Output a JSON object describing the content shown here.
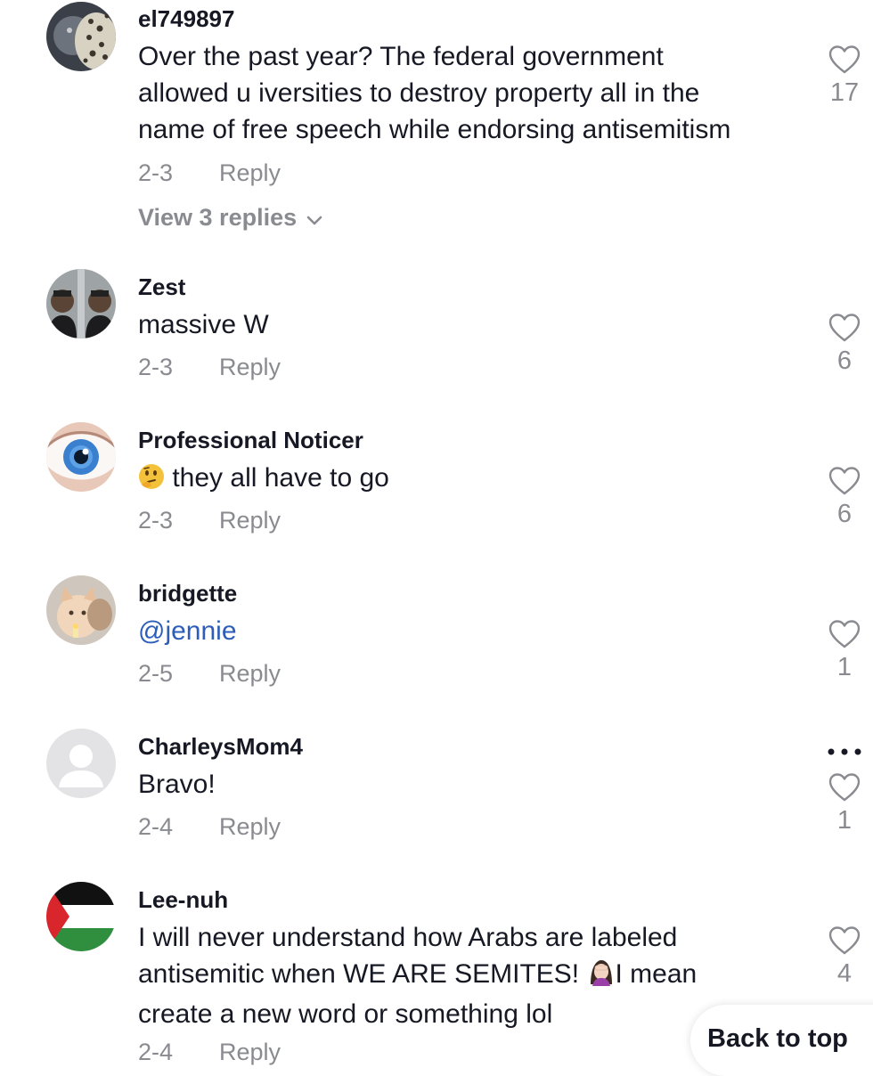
{
  "colors": {
    "text": "#161823",
    "meta": "#8a8b91",
    "mention": "#2b5db9"
  },
  "comments": [
    {
      "username": "el749897",
      "text_lines": [
        "Over the past year? The federal government",
        "allowed u iversities to destroy property all in the",
        "name of free speech while endorsing antisemitism"
      ],
      "date": "2-3",
      "reply_label": "Reply",
      "likes": "17",
      "view_replies": "View 3 replies",
      "avatar_icon": "leopard-cat-avatar"
    },
    {
      "username": "Zest",
      "text": "massive W",
      "date": "2-3",
      "reply_label": "Reply",
      "likes": "6",
      "avatar_icon": "two-men-avatar"
    },
    {
      "username": "Professional Noticer",
      "emoji": "thinking-face",
      "text": "they all have to go",
      "date": "2-3",
      "reply_label": "Reply",
      "likes": "6",
      "avatar_icon": "eye-avatar"
    },
    {
      "username": "bridgette",
      "mention": "@jennie",
      "date": "2-5",
      "reply_label": "Reply",
      "likes": "1",
      "avatar_icon": "cat-avatar"
    },
    {
      "username": "CharleysMom4",
      "text": "Bravo!",
      "date": "2-4",
      "reply_label": "Reply",
      "likes": "1",
      "avatar_icon": "default-user-avatar",
      "more_icon": "more-dots-icon"
    },
    {
      "username": "Lee-nuh",
      "text_lines": [
        "I will never understand how Arabs are labeled",
        "antisemitic when WE ARE SEMITES!",
        "I mean",
        "create a new word or something lol"
      ],
      "emoji": "facepalm-woman",
      "date": "2-4",
      "reply_label": "Reply",
      "likes": "4",
      "avatar_icon": "palestine-flag-avatar"
    }
  ],
  "back_to_top": "Back to top"
}
